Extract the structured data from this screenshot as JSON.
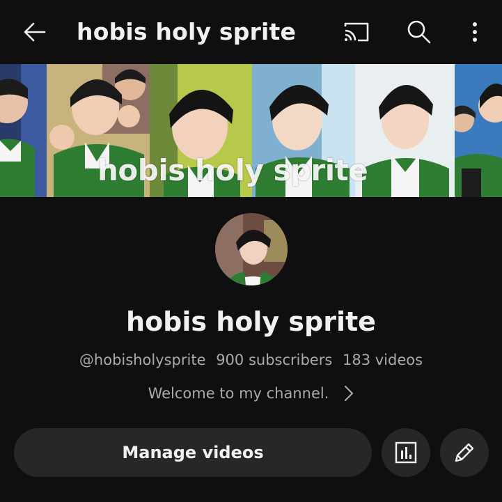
{
  "topbar": {
    "title": "hobis holy sprite",
    "back_icon": "arrow-left-icon",
    "cast_icon": "cast-icon",
    "search_icon": "search-icon",
    "more_icon": "more-vertical-icon"
  },
  "banner": {
    "overlay_text": "hobis holy sprite"
  },
  "channel": {
    "name": "hobis holy sprite",
    "handle": "@hobisholysprite",
    "subscribers": "900 subscribers",
    "videos": "183 videos",
    "description": "Welcome to my channel."
  },
  "actions": {
    "manage_label": "Manage videos",
    "analytics_icon": "analytics-icon",
    "edit_icon": "pencil-icon"
  },
  "colors": {
    "background": "#0f0f0f",
    "text_primary": "#f1f1f1",
    "text_secondary": "#aaaaaa",
    "button_bg": "#272727",
    "sweater_green": "#2e7d32"
  }
}
